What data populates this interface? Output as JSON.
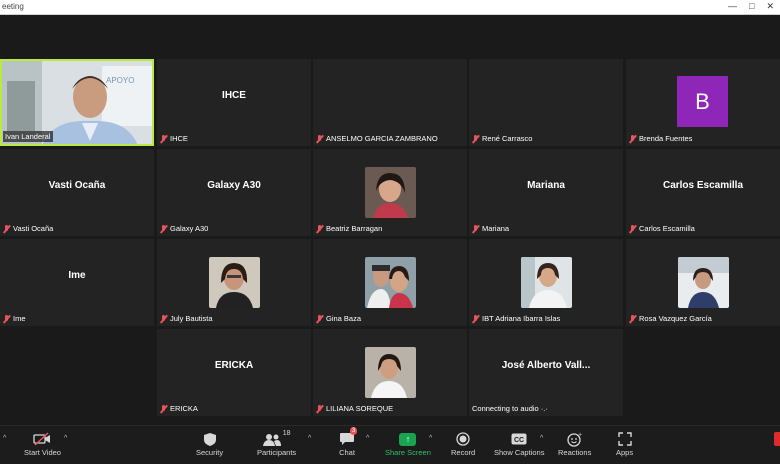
{
  "window": {
    "title": "eeting",
    "buttons": [
      "—",
      "□",
      "✕"
    ]
  },
  "participants": [
    {
      "name": "Ivan Landeral",
      "type": "video",
      "active": true,
      "muted": false,
      "big": ""
    },
    {
      "name": "IHCE",
      "type": "name",
      "muted": true,
      "big": "IHCE"
    },
    {
      "name": "ANSELMO GARCIA ZAMBRANO",
      "type": "blank",
      "muted": true,
      "big": ""
    },
    {
      "name": "René Carrasco",
      "type": "blank",
      "muted": true,
      "big": ""
    },
    {
      "name": "Brenda Fuentes",
      "type": "avatar",
      "muted": true,
      "big": "",
      "avatar_letter": "B"
    },
    {
      "name": "Vasti Ocaña",
      "type": "name",
      "muted": true,
      "big": "Vasti Ocaña"
    },
    {
      "name": "Galaxy A30",
      "type": "name",
      "muted": true,
      "big": "Galaxy A30"
    },
    {
      "name": "Beatriz Barragan",
      "type": "photo",
      "muted": true,
      "big": ""
    },
    {
      "name": "Mariana",
      "type": "name",
      "muted": true,
      "big": "Mariana"
    },
    {
      "name": "Carlos Escamilla",
      "type": "name",
      "muted": true,
      "big": "Carlos Escamilla"
    },
    {
      "name": "Ime",
      "type": "name",
      "muted": true,
      "big": "Ime"
    },
    {
      "name": "July Bautista",
      "type": "photo",
      "muted": true,
      "big": ""
    },
    {
      "name": "Gina Baza",
      "type": "photo",
      "muted": true,
      "big": ""
    },
    {
      "name": "IBT Adriana Ibarra Islas",
      "type": "photo",
      "muted": true,
      "big": ""
    },
    {
      "name": "Rosa Vazquez García",
      "type": "photo",
      "muted": true,
      "big": ""
    },
    {
      "name": "ERICKA",
      "type": "name",
      "muted": true,
      "big": "ERICKA"
    },
    {
      "name": "LILIANA SOREQUE",
      "type": "photo",
      "muted": true,
      "big": ""
    },
    {
      "name": "Connecting to audio ·.·",
      "type": "name",
      "muted": false,
      "big": "José Alberto Vall..."
    }
  ],
  "toolbar": {
    "start_video": "Start Video",
    "security": "Security",
    "participants": "Participants",
    "participants_count": "18",
    "chat": "Chat",
    "chat_badge": "3",
    "share_screen": "Share Screen",
    "record": "Record",
    "show_captions": "Show Captions",
    "reactions": "Reactions",
    "apps": "Apps"
  },
  "colors": {
    "accent_active": "#b8ea3f",
    "share_green": "#1ba44f",
    "avatar_purple": "#8e27b7",
    "muted_red": "#e8555b"
  }
}
